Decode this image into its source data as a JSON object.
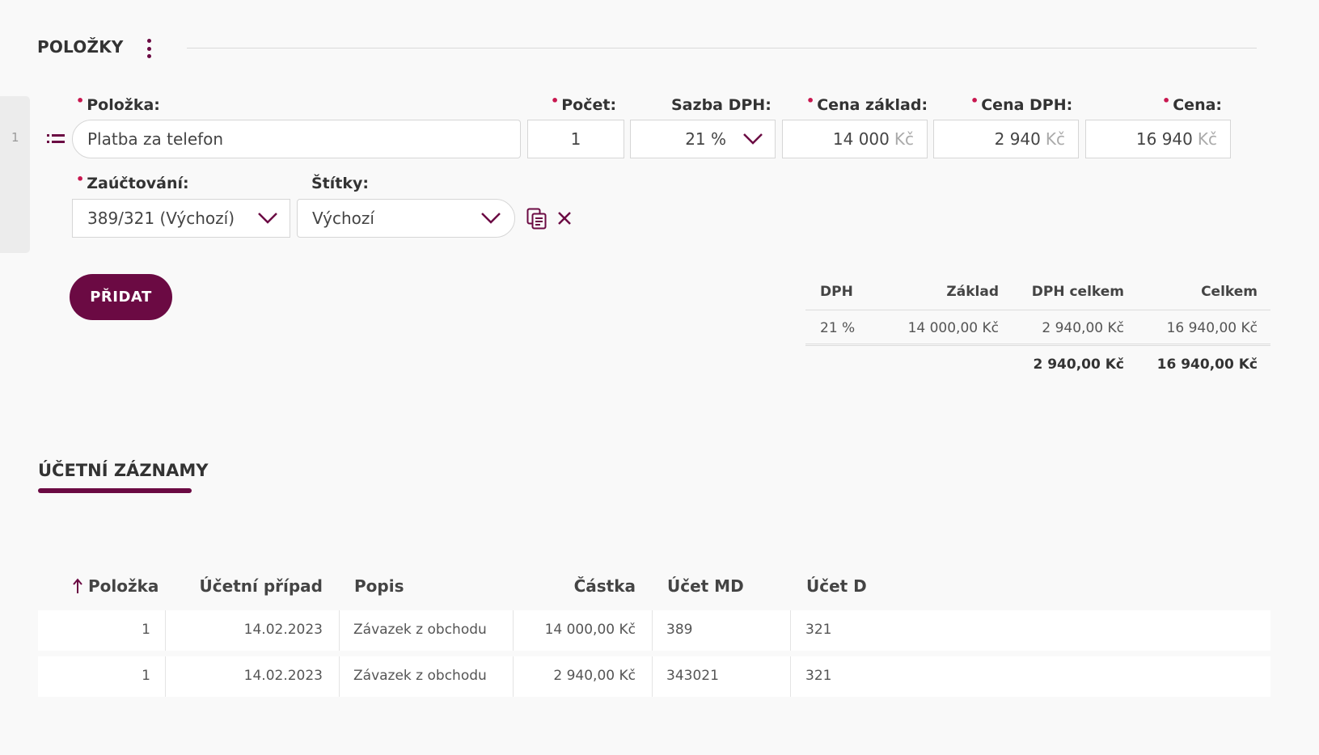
{
  "items_section": {
    "title": "POLOŽKY"
  },
  "item_row": {
    "index": "1",
    "labels": {
      "item": "Položka:",
      "count": "Počet:",
      "vat_rate": "Sazba DPH:",
      "base_price": "Cena základ:",
      "vat_price": "Cena DPH:",
      "price": "Cena:",
      "accounting": "Zaúčtování:",
      "tags": "Štítky:"
    },
    "values": {
      "item": "Platba za telefon",
      "count": "1",
      "vat_rate": "21 %",
      "base_price": "14 000",
      "vat_price": "2 940",
      "price": "16 940",
      "currency": "Kč",
      "accounting": "389/321 (Výchozí)",
      "tags": "Výchozí"
    }
  },
  "add_button": "PŘIDAT",
  "vat_summary": {
    "headers": [
      "DPH",
      "Základ",
      "DPH celkem",
      "Celkem"
    ],
    "row": [
      "21 %",
      "14 000,00 Kč",
      "2 940,00 Kč",
      "16 940,00 Kč"
    ],
    "totals": [
      "",
      "",
      "2 940,00 Kč",
      "16 940,00 Kč"
    ]
  },
  "records_tab": {
    "title": "ÚČETNÍ ZÁZNAMY"
  },
  "records_table": {
    "headers": [
      "Položka",
      "Účetní případ",
      "Popis",
      "Částka",
      "Účet MD",
      "Účet D"
    ],
    "rows": [
      [
        "1",
        "14.02.2023",
        "Závazek z obchodu",
        "14 000,00 Kč",
        "389",
        "321"
      ],
      [
        "1",
        "14.02.2023",
        "Závazek z obchodu",
        "2 940,00 Kč",
        "343021",
        "321"
      ]
    ]
  },
  "colors": {
    "accent": "#6b0a43",
    "required_marker": "#c8174f"
  }
}
